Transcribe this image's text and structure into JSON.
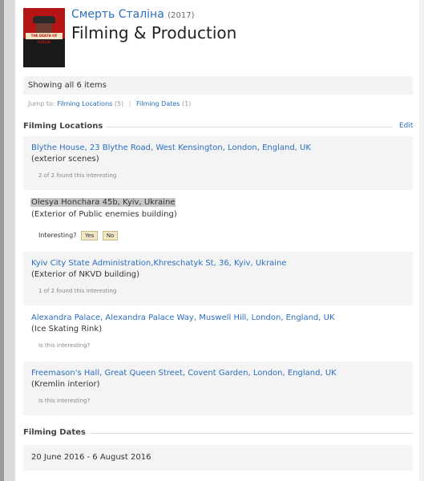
{
  "header": {
    "movie_title": "Смерть Сталіна",
    "year": "(2017)",
    "page_title": "Filming & Production"
  },
  "summary": {
    "showing": "Showing all 6 items",
    "jump_to_label": "Jump to:",
    "jump_links": [
      {
        "label": "Filming Locations",
        "count": "(5)"
      },
      {
        "label": "Filming Dates",
        "count": "(1)"
      }
    ]
  },
  "filming_locations": {
    "heading": "Filming Locations",
    "edit_label": "Edit",
    "items": [
      {
        "place": "Blythe House, 23 Blythe Road, West Kensington, London, England, UK",
        "note": "(exterior scenes)",
        "meta": "2 of 2 found this interesting"
      },
      {
        "place": "Olesya Honchara 45b, Kyiv, Ukraine",
        "note": "(Exterior of Public enemies building)",
        "interest_prompt": "Interesting?",
        "yes": "Yes",
        "no": "No"
      },
      {
        "place": "Kyiv City State Administration,Khreschatyk St, 36, Kyiv, Ukraine",
        "note": "(Exterior of NKVD building)",
        "meta": "1 of 2 found this interesting"
      },
      {
        "place": "Alexandra Palace, Alexandra Palace Way, Muswell Hill, London, England, UK",
        "note": "(Ice Skating Rink)",
        "meta": "Is this interesting?"
      },
      {
        "place": "Freemason's Hall, Great Queen Street, Covent Garden, London, England, UK",
        "note": "(Kremlin interior)",
        "meta": "Is this interesting?"
      }
    ]
  },
  "filming_dates": {
    "heading": "Filming Dates",
    "value": "20 June 2016 - 6 August 2016"
  },
  "poster": {
    "text": "THE DEATH OF STALIN"
  }
}
